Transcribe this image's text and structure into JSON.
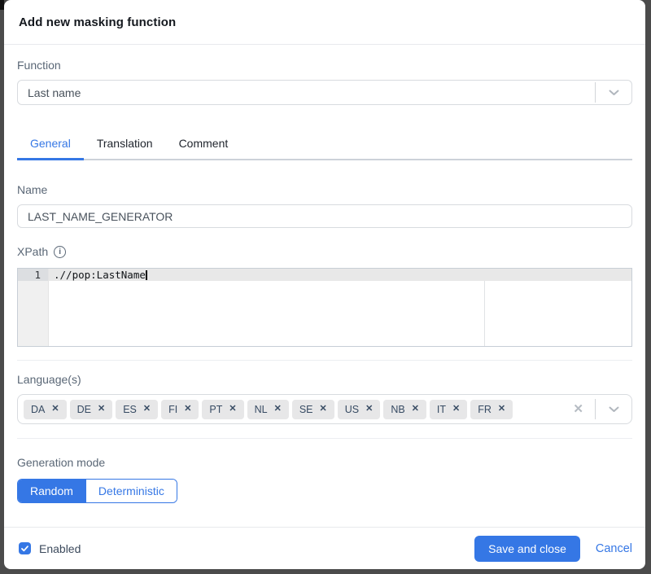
{
  "modal": {
    "title": "Add new masking function",
    "function_field": {
      "label": "Function",
      "value": "Last name"
    },
    "tabs": [
      {
        "label": "General",
        "active": true
      },
      {
        "label": "Translation",
        "active": false
      },
      {
        "label": "Comment",
        "active": false
      }
    ],
    "name_field": {
      "label": "Name",
      "value": "LAST_NAME_GENERATOR"
    },
    "xpath_field": {
      "label": "XPath",
      "line_number": "1",
      "code": ".//pop:LastName"
    },
    "languages_field": {
      "label": "Language(s)",
      "tags": [
        "DA",
        "DE",
        "ES",
        "FI",
        "PT",
        "NL",
        "SE",
        "US",
        "NB",
        "IT",
        "FR"
      ]
    },
    "generation_mode": {
      "label": "Generation mode",
      "options": [
        {
          "label": "Random",
          "selected": true
        },
        {
          "label": "Deterministic",
          "selected": false
        }
      ]
    },
    "footer": {
      "enabled_label": "Enabled",
      "enabled_checked": true,
      "save_label": "Save and close",
      "cancel_label": "Cancel"
    }
  },
  "icons": {
    "close": "✕",
    "info": "i",
    "chevron_down": "chevron-down",
    "check": "check"
  },
  "colors": {
    "accent": "#3577e5",
    "backdrop": "#4b4b4b",
    "tag_background": "#e7e7e8",
    "active_line": "#e8e8e8"
  }
}
